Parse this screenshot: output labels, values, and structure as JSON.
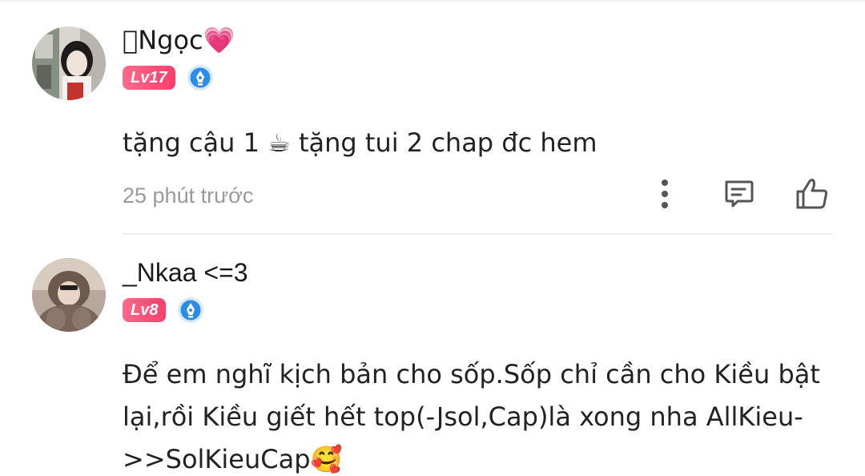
{
  "comments": [
    {
      "username": "\u0000Ngọc💗",
      "level": "Lv17",
      "text": "tặng cậu 1 ☕ tặng tui 2 chap đc hem",
      "timestamp": "25 phút trước"
    },
    {
      "username": "_Nkaa <=3",
      "level": "Lv8",
      "text": "Để em nghĩ kịch bản cho sốp.Sốp chỉ cần cho Kiều bật lại,rồi Kiều giết hết top(-Jsol,Cap)là xong nha AllKieu->>SolKieuCap🥰"
    }
  ],
  "icons": {
    "more": "more-vertical-icon",
    "reply": "comment-icon",
    "like": "thumbs-up-icon",
    "vip": "vip-pen-badge-icon"
  },
  "colors": {
    "level_badge": "#ff4a72",
    "vip_badge": "#2b8de8",
    "timestamp": "#9a9a9a",
    "icon": "#555555"
  }
}
